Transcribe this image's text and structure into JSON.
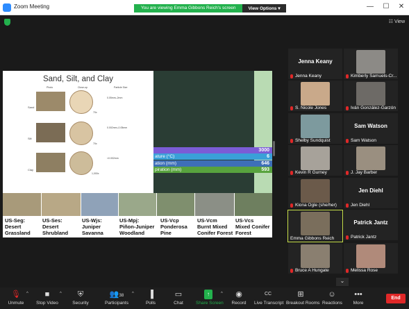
{
  "window": {
    "title": "Zoom Meeting",
    "minimize": "—",
    "maximize": "☐",
    "close": "✕"
  },
  "banner": {
    "viewing": "You are viewing Emma Gibbons Reich's screen",
    "view_options": "View Options ▾"
  },
  "top": {
    "view_label": "View"
  },
  "slide": {
    "title": "Sand, Silt, and Clay",
    "col_photo": "Photo",
    "col_closeup": "Close-up",
    "col_particle": "Particle Size",
    "rows": [
      {
        "label": "Sand",
        "size": "0.05mm–2mm",
        "mag": "70x"
      },
      {
        "label": "Silt",
        "size": "0.002mm–0.05mm",
        "mag": "70x"
      },
      {
        "label": "Clay",
        "size": "<0.002mm",
        "mag": "1,000x"
      }
    ],
    "climate": [
      {
        "label": "",
        "value": "3000",
        "color": "#7b5cd6"
      },
      {
        "label": "ature (°C)",
        "value": "6",
        "color": "#3aa0d8"
      },
      {
        "label": "ation (mm)",
        "value": "646",
        "color": "#3e6fb8"
      },
      {
        "label": "piration (mm)",
        "value": "593",
        "color": "#58a33e"
      }
    ],
    "ecosystems": [
      {
        "code": "US-Seg:",
        "l1": "Desert",
        "l2": "Grassland",
        "color": "#a89a7a"
      },
      {
        "code": "US-Ses:",
        "l1": "Desert",
        "l2": "Shrubland",
        "color": "#b8a886"
      },
      {
        "code": "US-Wjs:",
        "l1": "Juniper",
        "l2": "Savanna",
        "color": "#8fa2b8"
      },
      {
        "code": "US-Mpj:",
        "l1": "Piñon-Juniper",
        "l2": "Woodland",
        "color": "#9aa88a"
      },
      {
        "code": "US-Vcp",
        "l1": "Ponderosa",
        "l2": "Pine",
        "color": "#7f8f6e"
      },
      {
        "code": "US-Vcm",
        "l1": "Burnt Mixed",
        "l2": "Conifer Forest",
        "color": "#8b8f86"
      },
      {
        "code": "US-Vcs",
        "l1": "Mixed Conifer",
        "l2": "Forest",
        "color": "#6e7f5f"
      }
    ]
  },
  "participants": [
    {
      "name": "Jenna Keany",
      "center": "Jenna Keany",
      "photo": ""
    },
    {
      "name": "Kimberly Samuels-Cr...",
      "center": "",
      "photo": "#8c8a86"
    },
    {
      "name": "S. Nicole Jones",
      "center": "",
      "photo": "#c9a98a"
    },
    {
      "name": "Iván González-Garzón",
      "center": "",
      "photo": "#6d6a66"
    },
    {
      "name": "Shelby Sundquist",
      "center": "",
      "photo": "#7d9a9e"
    },
    {
      "name": "Sam Watson",
      "center": "Sam Watson",
      "photo": ""
    },
    {
      "name": "Kevin R Gurney",
      "center": "",
      "photo": "#a7a29a"
    },
    {
      "name": "J. Jay Barber",
      "center": "",
      "photo": "#9a8f80"
    },
    {
      "name": "Kiona Ogle (she/her)",
      "center": "",
      "photo": "#6b5a4a"
    },
    {
      "name": "Jen Diehl",
      "center": "Jen Diehl",
      "photo": ""
    },
    {
      "name": "Emma Gibbons Reich",
      "center": "",
      "photo": "#7a6e5c"
    },
    {
      "name": "Patrick Jantz",
      "center": "Patrick Jantz",
      "photo": ""
    },
    {
      "name": "Bruce A Hungate",
      "center": "",
      "photo": "#8a7f70"
    },
    {
      "name": "Melissa Rose",
      "center": "",
      "photo": "#b08a7a"
    }
  ],
  "toolbar": {
    "unmute": "Unmute",
    "stop_video": "Stop Video",
    "security": "Security",
    "participants": "Participants",
    "participants_count": "38",
    "polls": "Polls",
    "chat": "Chat",
    "share_screen": "Share Screen",
    "record": "Record",
    "live_transcript": "Live Transcript",
    "breakout_rooms": "Breakout Rooms",
    "reactions": "Reactions",
    "more": "More",
    "end": "End"
  },
  "colors": {
    "accent": "#2d8cff",
    "share_green": "#23b14d",
    "end_red": "#e02828",
    "active_border": "#c8e04a"
  }
}
